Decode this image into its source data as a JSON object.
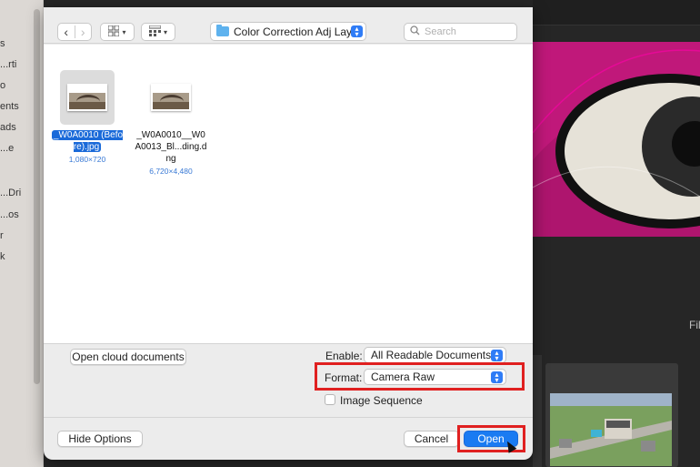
{
  "sidebar": {
    "items": [
      "s",
      "rti...",
      "o",
      "ents",
      "ads",
      "e...",
      "Dri...",
      "os...",
      "r",
      "k"
    ]
  },
  "toolbar": {
    "back_label": "‹",
    "forward_label": "›",
    "view_icon": "grid-view-icon",
    "group_icon": "group-icon",
    "location": "Color Correction Adj Layer",
    "search_placeholder": "Search"
  },
  "files": [
    {
      "name": "_W0A0010 (Before).jpg",
      "dims": "1,080×720",
      "selected": true
    },
    {
      "name": "_W0A0010__W0A0013_Bl...ding.dng",
      "dims": "6,720×4,480",
      "selected": false
    }
  ],
  "options": {
    "cloud_button": "Open cloud documents",
    "enable_label": "Enable:",
    "enable_value": "All Readable Documents",
    "format_label": "Format:",
    "format_value": "Camera Raw",
    "sequence_label": "Image Sequence",
    "sequence_checked": false
  },
  "footer": {
    "hide_options": "Hide Options",
    "cancel": "Cancel",
    "open": "Open"
  },
  "background": {
    "caption": "Filt",
    "accent_color": "#c0187a"
  }
}
